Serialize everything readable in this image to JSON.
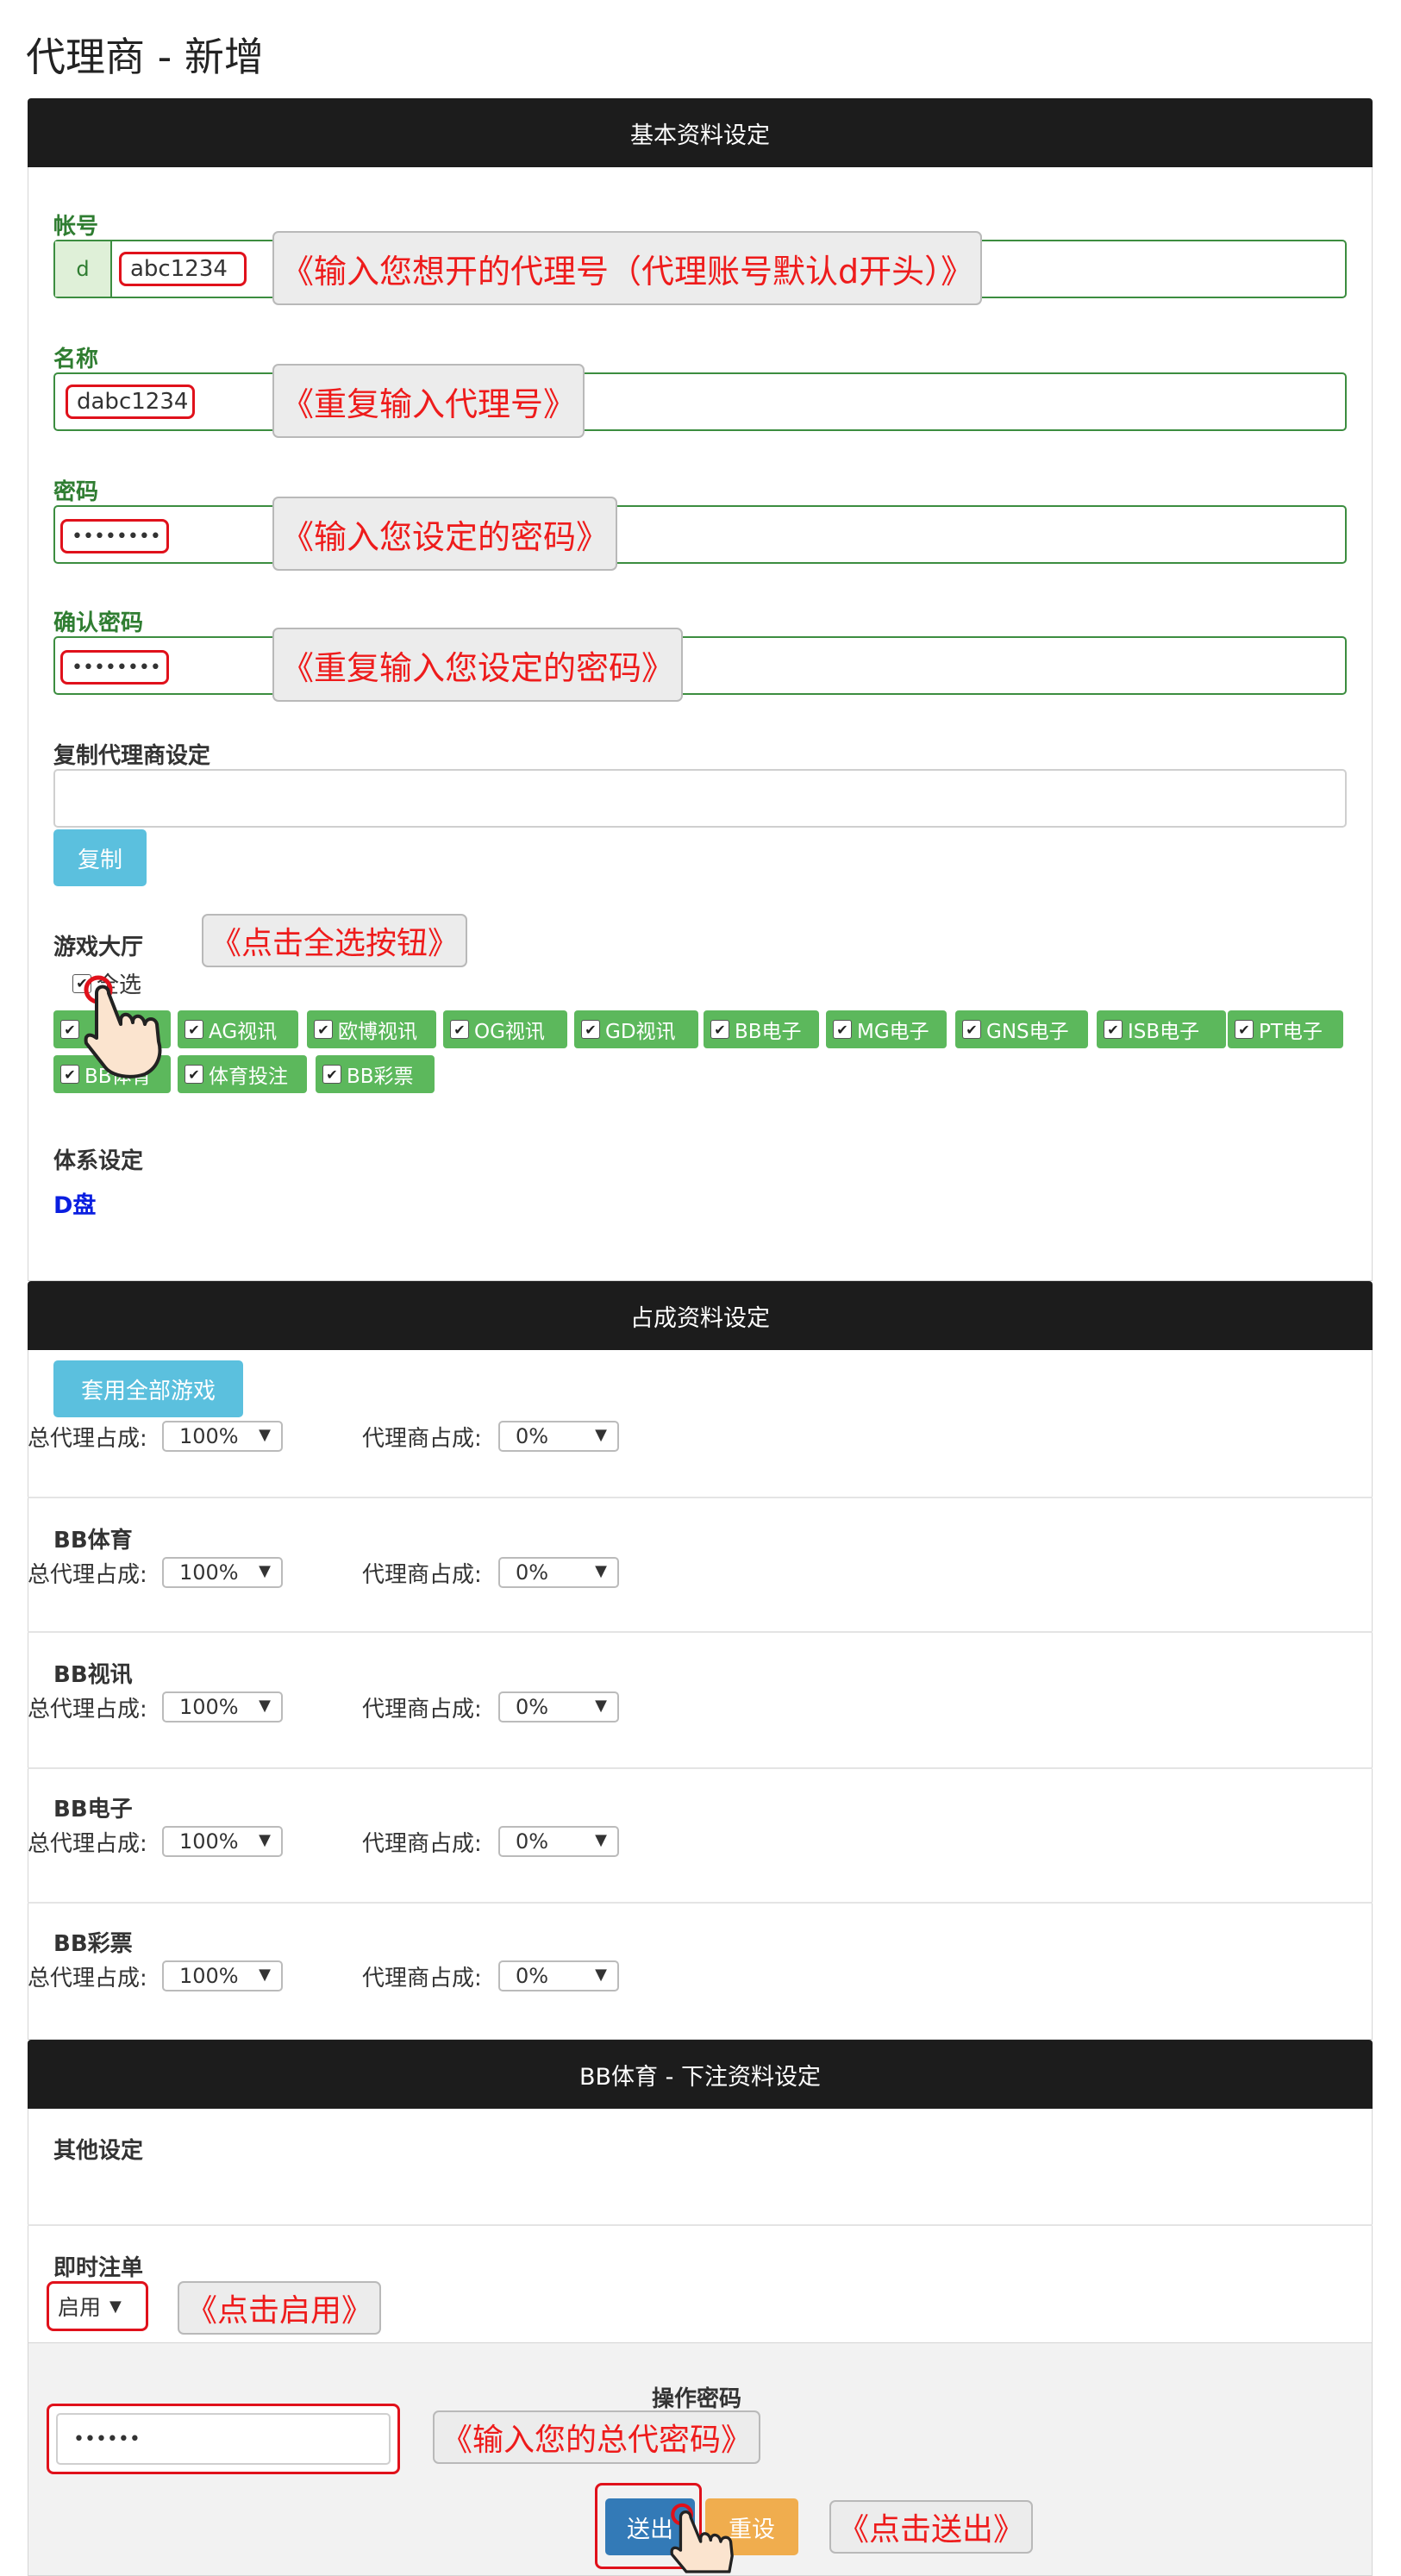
{
  "page": {
    "title": "代理商 - 新增"
  },
  "section_basic": {
    "header": "基本资料设定",
    "account": {
      "label": "帐号",
      "prefix": "d",
      "value": "abc1234",
      "callout": "《输入您想开的代理号（代理账号默认d开头）》"
    },
    "name": {
      "label": "名称",
      "value": "dabc1234",
      "callout": "《重复输入代理号》"
    },
    "password": {
      "label": "密码",
      "value": "••••••••",
      "callout": "《输入您设定的密码》"
    },
    "confirm_password": {
      "label": "确认密码",
      "value": "••••••••",
      "callout": "《重复输入您设定的密码》"
    },
    "copy_agent": {
      "label": "复制代理商设定",
      "value": "",
      "button": "复制"
    },
    "game_hall": {
      "label": "游戏大厅",
      "callout": "《点击全选按钮》",
      "select_all": "全选",
      "games": [
        "",
        "AG视讯",
        "欧博视讯",
        "OG视讯",
        "GD视讯",
        "BB电子",
        "MG电子",
        "GNS电子",
        "ISB电子",
        "PT电子",
        "BB体育",
        "体育投注",
        "BB彩票"
      ]
    },
    "system": {
      "label": "体系设定",
      "value": "D盘"
    }
  },
  "section_share": {
    "header": "占成资料设定",
    "apply_all_button": "套用全部游戏",
    "total_agent_label": "总代理占成:",
    "agent_label": "代理商占成:",
    "rows": [
      {
        "title": "",
        "total_value": "100%",
        "agent_value": "0%"
      },
      {
        "title": "BB体育",
        "total_value": "100%",
        "agent_value": "0%"
      },
      {
        "title": "BB视讯",
        "total_value": "100%",
        "agent_value": "0%"
      },
      {
        "title": "BB电子",
        "total_value": "100%",
        "agent_value": "0%"
      },
      {
        "title": "BB彩票",
        "total_value": "100%",
        "agent_value": "0%"
      }
    ]
  },
  "section_bet": {
    "header": "BB体育 - 下注资料设定",
    "other_label": "其他设定",
    "instant_label": "即时注单",
    "instant_value": "启用",
    "instant_callout": "《点击启用》"
  },
  "footer": {
    "op_password_label": "操作密码",
    "op_password_value": "••••••",
    "op_callout": "《输入您的总代密码》",
    "submit": "送出",
    "reset": "重设",
    "submit_callout": "《点击送出》"
  },
  "colors": {
    "green_label": "#2f7d31",
    "header_bg": "#1c1c1c",
    "info_button": "#5bc0de",
    "chip_green": "#5cb85c",
    "submit_blue": "#337ab7",
    "reset_orange": "#f0ad4e",
    "annotation_red": "#ee1b1b"
  }
}
